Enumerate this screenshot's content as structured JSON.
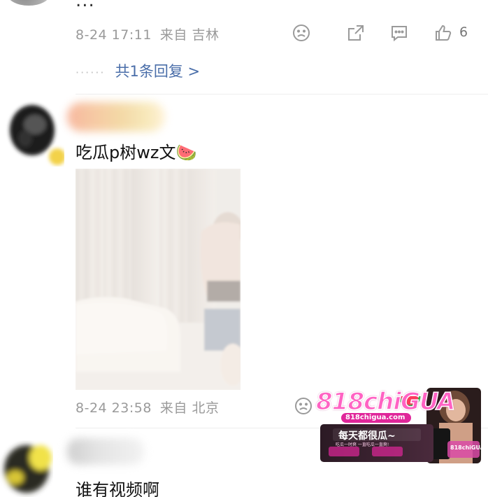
{
  "first_comment": {
    "partial_text": "...",
    "date": "8-24 17:11",
    "location_label": "来自 吉林",
    "like_count": "6",
    "replies_label": "共1条回复 >"
  },
  "second_comment": {
    "text": "吃瓜p树wz文🍉",
    "date": "8-24 23:58",
    "location_label": "来自 北京"
  },
  "third_comment": {
    "text": "谁有视频啊"
  },
  "ad_banner": {
    "logo_text": "818chiGUA",
    "url": "818chigua.com",
    "slogan": "每天都很瓜~",
    "tagline": "吃瓜一时爽 一直吃瓜一直爽!",
    "side_logo": "818chiGUA",
    "colors": {
      "accent": "#e0269a",
      "dark": "#1a1a1a",
      "brand": "#ff4fb6"
    }
  },
  "icons": [
    "dislike-icon",
    "share-icon",
    "comment-icon",
    "like-icon"
  ]
}
